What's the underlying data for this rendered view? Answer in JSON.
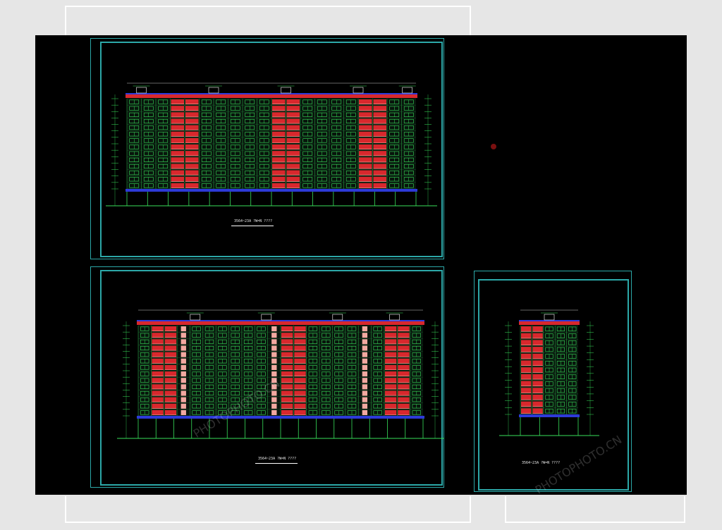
{
  "drawings": {
    "top_elevation": {
      "caption": "3564~23A ?W=N ????"
    },
    "bottom_elevation": {
      "caption": "3564~23A ?W=N ????"
    },
    "side_elevation": {
      "caption": "3564~23A ?W=N ????"
    }
  },
  "watermark": {
    "text": "PHOTOPHOTO.CN"
  },
  "colors": {
    "background": "#000000",
    "frame": "#2ca8a8",
    "wall_red": "#d8282d",
    "window_green": "#38e05a",
    "slab_blue": "#2d3ad8",
    "pink": "#f2a8a0",
    "white": "#ffffff"
  }
}
